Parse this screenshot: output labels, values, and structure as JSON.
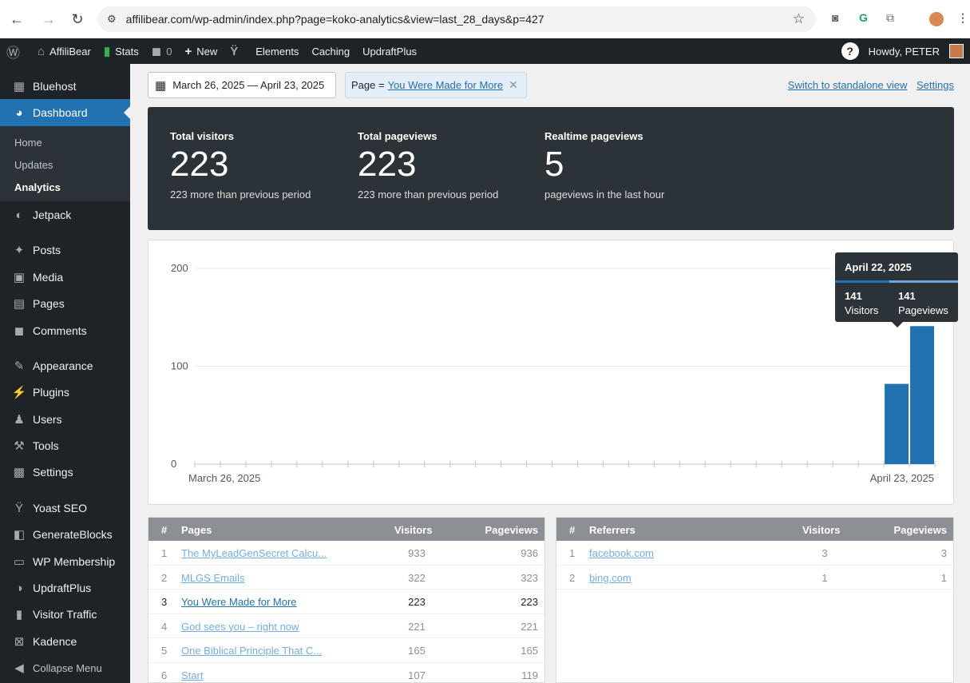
{
  "browser": {
    "url": "affilibear.com/wp-admin/index.php?page=koko-analytics&view=last_28_days&p=427"
  },
  "adminbar": {
    "site_name": "AffiliBear",
    "stats": "Stats",
    "comments_count": "0",
    "new": "New",
    "elements": "Elements",
    "caching": "Caching",
    "updraft": "UpdraftPlus",
    "howdy": "Howdy, PETER"
  },
  "sidebar": {
    "items": [
      {
        "label": "Bluehost",
        "icon": "grid-icon"
      },
      {
        "label": "Dashboard",
        "icon": "dashboard-icon"
      },
      {
        "label": "Jetpack",
        "icon": "jetpack-icon"
      },
      {
        "label": "Posts",
        "icon": "pin-icon"
      },
      {
        "label": "Media",
        "icon": "media-icon"
      },
      {
        "label": "Pages",
        "icon": "pages-icon"
      },
      {
        "label": "Comments",
        "icon": "comment-icon"
      },
      {
        "label": "Appearance",
        "icon": "brush-icon"
      },
      {
        "label": "Plugins",
        "icon": "plugin-icon"
      },
      {
        "label": "Users",
        "icon": "user-icon"
      },
      {
        "label": "Tools",
        "icon": "wrench-icon"
      },
      {
        "label": "Settings",
        "icon": "settings-icon"
      },
      {
        "label": "Yoast SEO",
        "icon": "yoast-icon"
      },
      {
        "label": "GenerateBlocks",
        "icon": "generateblocks-icon"
      },
      {
        "label": "WP Membership",
        "icon": "membership-icon"
      },
      {
        "label": "UpdraftPlus",
        "icon": "updraft-icon"
      },
      {
        "label": "Visitor Traffic",
        "icon": "traffic-icon"
      },
      {
        "label": "Kadence",
        "icon": "kadence-icon"
      },
      {
        "label": "Collapse Menu",
        "icon": "collapse-icon"
      }
    ],
    "submenu": [
      "Home",
      "Updates",
      "Analytics"
    ]
  },
  "filters": {
    "date_range": "March 26, 2025 — April 23, 2025",
    "page_prefix": "Page =",
    "page_title": "You Were Made for More",
    "standalone": "Switch to standalone view",
    "settings": "Settings"
  },
  "totals": [
    {
      "label": "Total visitors",
      "value": "223",
      "sub": "223 more than previous period"
    },
    {
      "label": "Total pageviews",
      "value": "223",
      "sub": "223 more than previous period"
    },
    {
      "label": "Realtime pageviews",
      "value": "5",
      "sub": "pageviews in the last hour"
    }
  ],
  "chart_data": {
    "type": "bar",
    "x_start_label": "March 26, 2025",
    "x_end_label": "April 23, 2025",
    "y_ticks": [
      0,
      100,
      200
    ],
    "ylim": [
      0,
      200
    ],
    "num_days": 29,
    "series": [
      {
        "name": "Visitors",
        "values": [
          0,
          0,
          0,
          0,
          0,
          0,
          0,
          0,
          0,
          0,
          0,
          0,
          0,
          0,
          0,
          0,
          0,
          0,
          0,
          0,
          0,
          0,
          0,
          0,
          0,
          0,
          0,
          82,
          141
        ]
      },
      {
        "name": "Pageviews",
        "values": [
          0,
          0,
          0,
          0,
          0,
          0,
          0,
          0,
          0,
          0,
          0,
          0,
          0,
          0,
          0,
          0,
          0,
          0,
          0,
          0,
          0,
          0,
          0,
          0,
          0,
          0,
          0,
          82,
          141
        ]
      }
    ],
    "tooltip": {
      "date": "April 22, 2025",
      "visitors": "141",
      "visitors_label": "Visitors",
      "pageviews": "141",
      "pageviews_label": "Pageviews"
    }
  },
  "pages_table": {
    "headers": [
      "#",
      "Pages",
      "Visitors",
      "Pageviews"
    ],
    "rows": [
      {
        "n": "1",
        "title": "The MyLeadGenSecret Calcu...",
        "visitors": "933",
        "pageviews": "936"
      },
      {
        "n": "2",
        "title": "MLGS Emails",
        "visitors": "322",
        "pageviews": "323"
      },
      {
        "n": "3",
        "title": "You Were Made for More",
        "visitors": "223",
        "pageviews": "223"
      },
      {
        "n": "4",
        "title": "God sees you – right now",
        "visitors": "221",
        "pageviews": "221"
      },
      {
        "n": "5",
        "title": "One Biblical Principle That C...",
        "visitors": "165",
        "pageviews": "165"
      },
      {
        "n": "6",
        "title": "Start",
        "visitors": "107",
        "pageviews": "119"
      }
    ]
  },
  "referrers_table": {
    "headers": [
      "#",
      "Referrers",
      "Visitors",
      "Pageviews"
    ],
    "rows": [
      {
        "n": "1",
        "title": "facebook.com",
        "visitors": "3",
        "pageviews": "3"
      },
      {
        "n": "2",
        "title": "bing.com",
        "visitors": "1",
        "pageviews": "1"
      }
    ]
  },
  "colors": {
    "accent": "#2271b1",
    "bar": "#2271b1",
    "admin_dark": "#1d2327"
  }
}
